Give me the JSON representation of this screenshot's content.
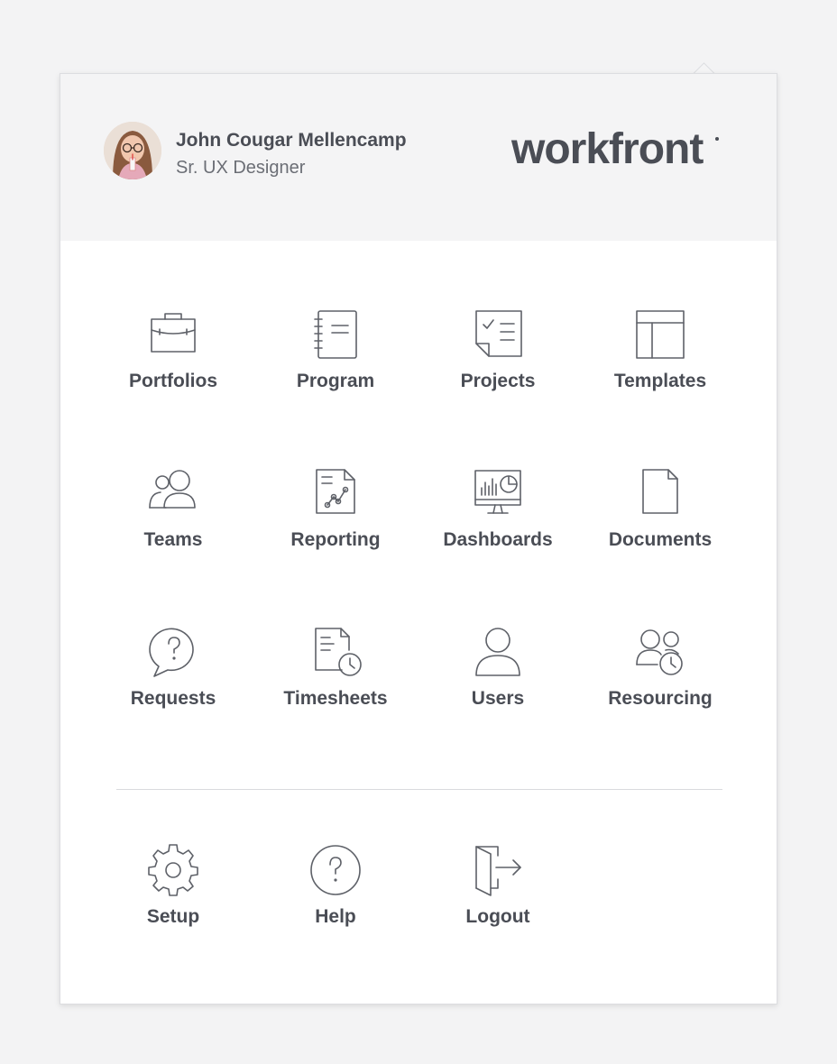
{
  "header": {
    "user_name": "John Cougar Mellencamp",
    "user_role": "Sr. UX Designer",
    "brand": "workfront"
  },
  "menu": {
    "items": [
      {
        "label": "Portfolios",
        "icon": "briefcase-icon"
      },
      {
        "label": "Program",
        "icon": "notebook-icon"
      },
      {
        "label": "Projects",
        "icon": "checklist-icon"
      },
      {
        "label": "Templates",
        "icon": "layout-icon"
      },
      {
        "label": "Teams",
        "icon": "team-icon"
      },
      {
        "label": "Reporting",
        "icon": "report-icon"
      },
      {
        "label": "Dashboards",
        "icon": "monitor-chart-icon"
      },
      {
        "label": "Documents",
        "icon": "document-icon"
      },
      {
        "label": "Requests",
        "icon": "question-bubble-icon"
      },
      {
        "label": "Timesheets",
        "icon": "timesheet-icon"
      },
      {
        "label": "Users",
        "icon": "user-icon"
      },
      {
        "label": "Resourcing",
        "icon": "people-clock-icon"
      }
    ],
    "footer_items": [
      {
        "label": "Setup",
        "icon": "gear-icon"
      },
      {
        "label": "Help",
        "icon": "help-circle-icon"
      },
      {
        "label": "Logout",
        "icon": "logout-icon"
      }
    ]
  },
  "colors": {
    "background": "#f3f3f4",
    "header_bg": "#f4f4f5",
    "text": "#4a4d55",
    "icon_stroke": "#5e6168"
  }
}
